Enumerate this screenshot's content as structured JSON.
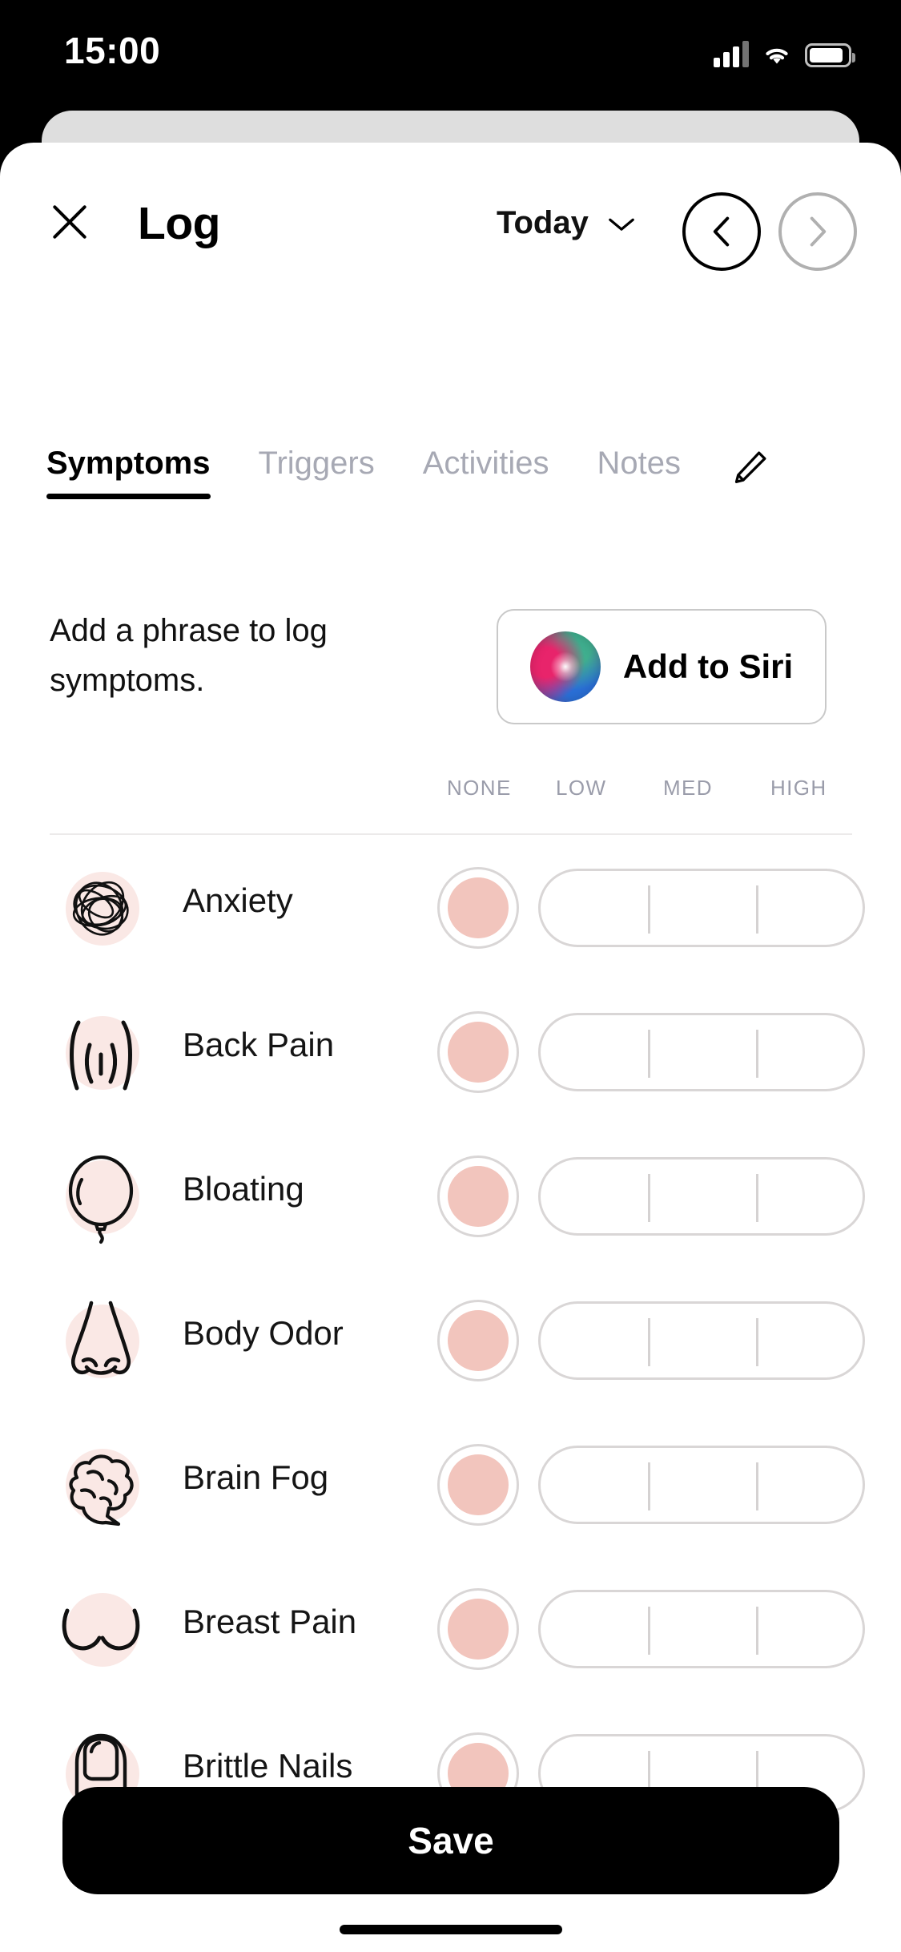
{
  "status_bar": {
    "time": "15:00",
    "signal_icon": "cellular-signal-icon",
    "wifi_icon": "wifi-icon",
    "battery_icon": "battery-icon"
  },
  "header": {
    "close_icon": "close-icon",
    "title": "Log",
    "date_label": "Today",
    "chevron_icon": "chevron-down-icon",
    "prev_icon": "chevron-left-icon",
    "next_icon": "chevron-right-icon",
    "prev_enabled": true,
    "next_enabled": false
  },
  "tabs": {
    "items": [
      {
        "label": "Symptoms",
        "active": true
      },
      {
        "label": "Triggers",
        "active": false
      },
      {
        "label": "Activities",
        "active": false
      },
      {
        "label": "Notes",
        "active": false
      }
    ],
    "edit_icon": "pencil-edit-icon"
  },
  "siri": {
    "prompt": "Add a phrase to log symptoms.",
    "button_label": "Add to Siri",
    "orb_icon": "siri-orb-icon"
  },
  "severity_levels": [
    "NONE",
    "LOW",
    "MED",
    "HIGH"
  ],
  "symptoms": [
    {
      "name": "Anxiety",
      "icon": "scribble-icon",
      "severity": "NONE"
    },
    {
      "name": "Back Pain",
      "icon": "back-torso-icon",
      "severity": "NONE"
    },
    {
      "name": "Bloating",
      "icon": "balloon-icon",
      "severity": "NONE"
    },
    {
      "name": "Body Odor",
      "icon": "nose-icon",
      "severity": "NONE"
    },
    {
      "name": "Brain Fog",
      "icon": "brain-icon",
      "severity": "NONE"
    },
    {
      "name": "Breast Pain",
      "icon": "breasts-icon",
      "severity": "NONE"
    },
    {
      "name": "Brittle Nails",
      "icon": "fingernail-icon",
      "severity": "NONE"
    }
  ],
  "footer": {
    "save_label": "Save"
  },
  "colors": {
    "accent_pink": "#f2c5bd",
    "icon_bg_pink": "#fae8e5",
    "muted_text": "#a7a9b4",
    "primary": "#000000"
  }
}
